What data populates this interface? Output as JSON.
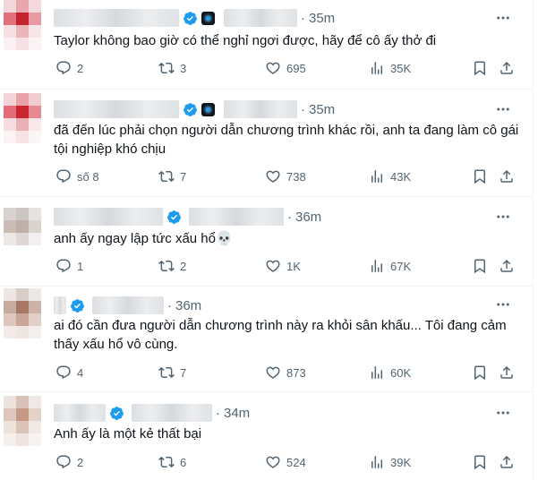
{
  "colors": {
    "text": "#0f1419",
    "muted": "#536471",
    "verified": "#1d9bf0",
    "divider": "#eff3f4"
  },
  "tweets": [
    {
      "time": "35m",
      "text": "Taylor không bao giờ có thể nghỉ ngơi được, hãy để cô ấy thở đi",
      "replies": "2",
      "reposts": "3",
      "likes": "695",
      "views": "35K"
    },
    {
      "time": "35m",
      "text": "đã đến lúc phải chọn người dẫn chương trình khác rồi, anh ta đang làm cô gái tội nghiệp khó chịu",
      "replies": "số 8",
      "reposts": "7",
      "likes": "738",
      "views": "43K"
    },
    {
      "time": "36m",
      "text": "anh ấy ngay lập tức xấu hổ💀",
      "replies": "1",
      "reposts": "2",
      "likes": "1K",
      "views": "67K"
    },
    {
      "time": "36m",
      "text": "ai đó cần đưa người dẫn chương trình này ra khỏi sân khấu... Tôi đang cảm thấy xấu hổ vô cùng.",
      "replies": "4",
      "reposts": "7",
      "likes": "873",
      "views": "60K"
    },
    {
      "time": "34m",
      "text": "Anh ấy là một kẻ thất bại",
      "replies": "2",
      "reposts": "6",
      "likes": "524",
      "views": "39K"
    }
  ]
}
